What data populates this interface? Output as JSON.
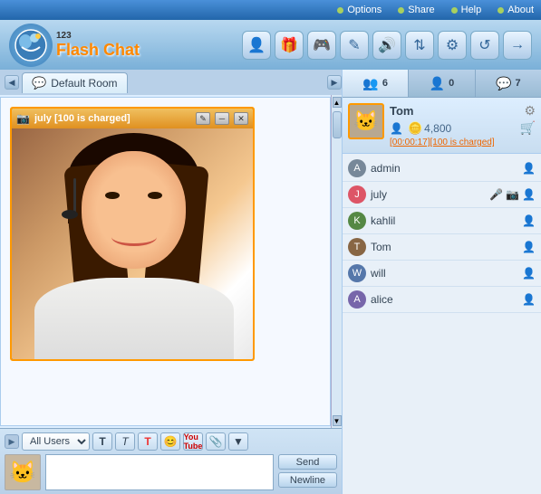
{
  "topbar": {
    "options": "Options",
    "share": "Share",
    "help": "Help",
    "about": "About"
  },
  "logo": {
    "prefix": "123",
    "title": "Flash Chat"
  },
  "toolbar_buttons": [
    {
      "icon": "👤",
      "label": "profile-btn"
    },
    {
      "icon": "🎁",
      "label": "gift-btn"
    },
    {
      "icon": "🎮",
      "label": "games-btn"
    },
    {
      "icon": "✏️",
      "label": "edit-btn"
    },
    {
      "icon": "🔊",
      "label": "sound-btn"
    },
    {
      "icon": "⇅",
      "label": "transfer-btn"
    },
    {
      "icon": "⚙",
      "label": "settings-btn"
    },
    {
      "icon": "↺",
      "label": "refresh-btn"
    },
    {
      "icon": "→",
      "label": "next-btn"
    }
  ],
  "room": {
    "name": "Default Room"
  },
  "video": {
    "user": "july",
    "title": "july [100 is charged]"
  },
  "bottom": {
    "recipient": "All Users",
    "send_label": "Send",
    "newline_label": "Newline"
  },
  "right_panel": {
    "tabs": [
      {
        "icon": "👥",
        "count": "6",
        "label": "users-tab"
      },
      {
        "icon": "👤",
        "count": "0",
        "label": "friends-tab"
      },
      {
        "icon": "💬",
        "count": "7",
        "label": "messages-tab"
      }
    ],
    "featured": {
      "name": "Tom",
      "coins": "4,800",
      "timer": "[00:00:17][100 is charged]"
    },
    "users": [
      {
        "name": "admin",
        "color": "av-gray",
        "icons": [
          "👤"
        ],
        "is_admin": true
      },
      {
        "name": "july",
        "color": "av-pink",
        "icons": [
          "🎤",
          "📷"
        ],
        "is_admin": false
      },
      {
        "name": "kahlil",
        "color": "av-green",
        "icons": [
          "👤"
        ],
        "is_admin": false
      },
      {
        "name": "Tom",
        "color": "av-brown",
        "icons": [
          "👤"
        ],
        "is_admin": false
      },
      {
        "name": "will",
        "color": "av-blue",
        "icons": [
          "👤"
        ],
        "is_admin": false
      },
      {
        "name": "alice",
        "color": "av-purple",
        "icons": [
          "👤"
        ],
        "is_admin": false
      }
    ]
  }
}
